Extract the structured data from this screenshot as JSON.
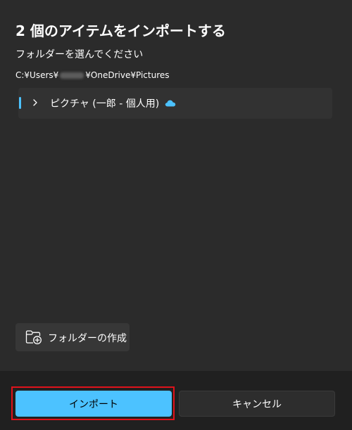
{
  "dialog": {
    "title": "2 個のアイテムをインポートする",
    "subtitle": "フォルダーを選んでください",
    "path": {
      "prefix": "C:¥Users¥",
      "suffix": "¥OneDrive¥Pictures"
    }
  },
  "tree": {
    "items": [
      {
        "label": "ピクチャ (一郎 - 個人用)",
        "icon": "onedrive-cloud-icon",
        "expanded": false,
        "selected": true
      }
    ]
  },
  "actions": {
    "new_folder_label": "フォルダーの作成",
    "import_label": "インポート",
    "cancel_label": "キャンセル"
  },
  "colors": {
    "accent": "#4cc2ff",
    "highlight": "#e0121b",
    "background": "#2b2b2b",
    "footer": "#202020"
  }
}
